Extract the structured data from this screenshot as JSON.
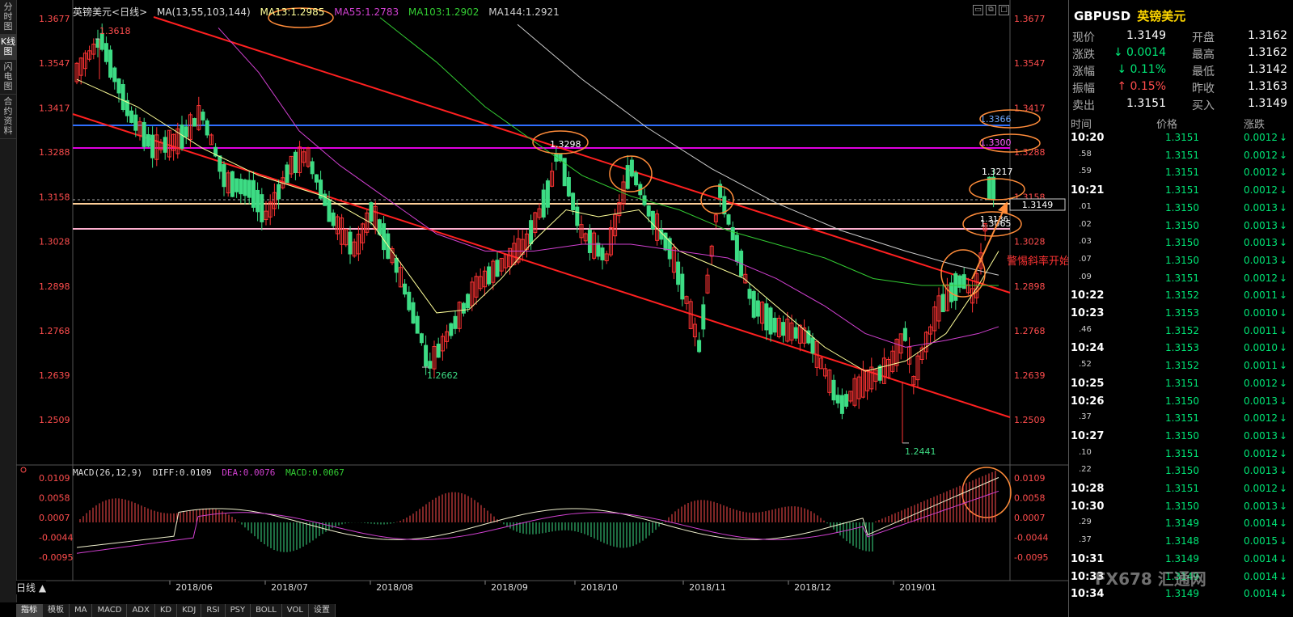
{
  "left_tabs": [
    "分时图",
    "K线图",
    "闪电图",
    "合约资料"
  ],
  "header": {
    "symbol_name": "英镑美元",
    "period_tag": "<日线>",
    "ma_label": "MA(13,55,103,144)",
    "ma13": "MA13:1.2985",
    "ma55": "MA55:1.2783",
    "ma103": "MA103:1.2902",
    "ma144": "MA144:1.2921"
  },
  "price_axis_left": [
    "1.3677",
    "1.3547",
    "1.3417",
    "1.3288",
    "1.3158",
    "1.3028",
    "1.2898",
    "1.2768",
    "1.2639",
    "1.2509"
  ],
  "price_axis_right": [
    "1.3677",
    "1.3547",
    "1.3417",
    "1.3288",
    "1.3158",
    "1.3028",
    "1.2898",
    "1.2768",
    "1.2639",
    "1.2509"
  ],
  "date_axis": [
    "2018/06",
    "2018/07",
    "2018/08",
    "2018/09",
    "2018/10",
    "2018/11",
    "2018/12",
    "2019/01"
  ],
  "annotations": {
    "high_1": "1.3618",
    "low_1": "1.2662",
    "high_2": "1.3298",
    "high_3": "1.3217",
    "low_2": "1.2441",
    "level_1": "1.3366",
    "level_2": "1.3300",
    "level_3": "1.3065",
    "level_4": "1.3136",
    "current_price": "1.3149",
    "warning_text": "警惕斜率开始变陡"
  },
  "macd": {
    "label": "MACD(26,12,9)",
    "diff": "DIFF:0.0109",
    "dea": "DEA:0.0076",
    "macd": "MACD:0.0067",
    "axis_left": [
      "0.0109",
      "0.0058",
      "0.0007",
      "-0.0044",
      "-0.0095"
    ],
    "axis_right": [
      "0.0109",
      "0.0058",
      "0.0007",
      "-0.0044",
      "-0.0095"
    ]
  },
  "period_button": "日线 ▲",
  "indicator_tabs": [
    "指标",
    "模板",
    "MA",
    "MACD",
    "ADX",
    "KD",
    "KDJ",
    "RSI",
    "PSY",
    "BOLL",
    "VOL",
    "设置"
  ],
  "panel": {
    "code": "GBPUSD",
    "name": "英镑美元",
    "quotes": [
      {
        "label": "现价",
        "value": "1.3149",
        "label2": "开盘",
        "value2": "1.3162"
      },
      {
        "label": "涨跌",
        "value": "0.0014",
        "label2": "最高",
        "value2": "1.3162"
      },
      {
        "label": "涨幅",
        "value": "0.11%",
        "label2": "最低",
        "value2": "1.3142"
      },
      {
        "label": "振幅",
        "value": "0.15%",
        "label2": "昨收",
        "value2": "1.3163"
      },
      {
        "label": "卖出",
        "value": "1.3151",
        "label2": "买入",
        "value2": "1.3149"
      }
    ],
    "ticks_head": {
      "time": "时间",
      "price": "价格",
      "change": "涨跌"
    },
    "ticks": [
      {
        "t": "10:20",
        "p": "1.3151",
        "c": "0.0012"
      },
      {
        "t": ".58",
        "p": "1.3151",
        "c": "0.0012"
      },
      {
        "t": ".59",
        "p": "1.3151",
        "c": "0.0012"
      },
      {
        "t": "10:21",
        "p": "1.3151",
        "c": "0.0012"
      },
      {
        "t": ".01",
        "p": "1.3150",
        "c": "0.0013"
      },
      {
        "t": ".02",
        "p": "1.3150",
        "c": "0.0013"
      },
      {
        "t": ".03",
        "p": "1.3150",
        "c": "0.0013"
      },
      {
        "t": ".07",
        "p": "1.3150",
        "c": "0.0013"
      },
      {
        "t": ".09",
        "p": "1.3151",
        "c": "0.0012"
      },
      {
        "t": "10:22",
        "p": "1.3152",
        "c": "0.0011"
      },
      {
        "t": "10:23",
        "p": "1.3153",
        "c": "0.0010"
      },
      {
        "t": ".46",
        "p": "1.3152",
        "c": "0.0011"
      },
      {
        "t": "10:24",
        "p": "1.3153",
        "c": "0.0010"
      },
      {
        "t": ".52",
        "p": "1.3152",
        "c": "0.0011"
      },
      {
        "t": "10:25",
        "p": "1.3151",
        "c": "0.0012"
      },
      {
        "t": "10:26",
        "p": "1.3150",
        "c": "0.0013"
      },
      {
        "t": ".37",
        "p": "1.3151",
        "c": "0.0012"
      },
      {
        "t": "10:27",
        "p": "1.3150",
        "c": "0.0013"
      },
      {
        "t": ".10",
        "p": "1.3151",
        "c": "0.0012"
      },
      {
        "t": ".22",
        "p": "1.3150",
        "c": "0.0013"
      },
      {
        "t": "10:28",
        "p": "1.3151",
        "c": "0.0012"
      },
      {
        "t": "10:30",
        "p": "1.3150",
        "c": "0.0013"
      },
      {
        "t": ".29",
        "p": "1.3149",
        "c": "0.0014"
      },
      {
        "t": ".37",
        "p": "1.3148",
        "c": "0.0015"
      },
      {
        "t": "10:31",
        "p": "1.3149",
        "c": "0.0014"
      },
      {
        "t": "10:33",
        "p": "1.3149",
        "c": "0.0014"
      },
      {
        "t": "10:34",
        "p": "1.3149",
        "c": "0.0014"
      }
    ]
  },
  "watermark": "FX678 汇通网",
  "colors": {
    "up": "#ff3333",
    "down": "#3ddc84",
    "level_blue": "#2f6fff",
    "level_magenta": "#e000e0",
    "level_pink": "#ffb0d0",
    "orange": "#ff8c3a"
  }
}
